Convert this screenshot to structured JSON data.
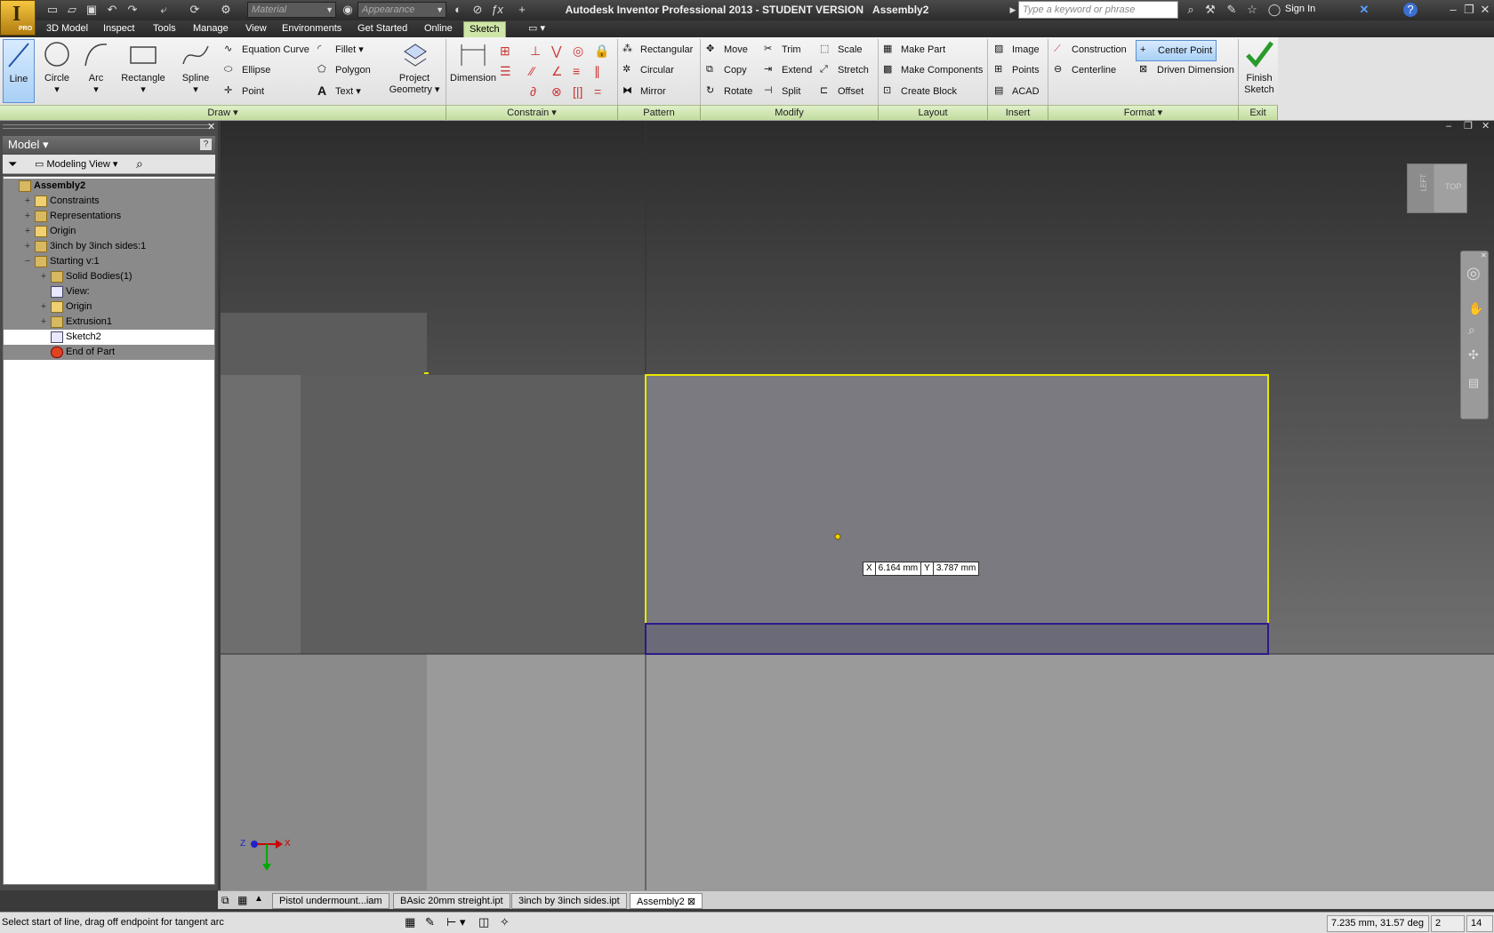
{
  "window": {
    "title": "Autodesk Inventor Professional 2013 - STUDENT VERSION",
    "document": "Assembly2",
    "app_badge": "PRO"
  },
  "qat": {
    "material_placeholder": "Material",
    "appearance_placeholder": "Appearance",
    "search_placeholder": "Type a keyword or phrase",
    "sign_in": "Sign In"
  },
  "menu_tabs": [
    "3D Model",
    "Inspect",
    "Tools",
    "Manage",
    "View",
    "Environments",
    "Get Started",
    "Online",
    "Sketch"
  ],
  "ribbon": {
    "draw": {
      "label": "Draw",
      "line": "Line",
      "circle": "Circle",
      "arc": "Arc",
      "rectangle": "Rectangle",
      "spline": "Spline",
      "equation_curve": "Equation Curve",
      "ellipse": "Ellipse",
      "point": "Point",
      "fillet": "Fillet",
      "polygon": "Polygon",
      "text": "Text",
      "project_geometry": [
        "Project",
        "Geometry"
      ]
    },
    "constrain": {
      "label": "Constrain",
      "dimension": "Dimension"
    },
    "pattern": {
      "label": "Pattern",
      "rectangular": "Rectangular",
      "circular": "Circular",
      "mirror": "Mirror"
    },
    "modify": {
      "label": "Modify",
      "move": "Move",
      "copy": "Copy",
      "rotate": "Rotate",
      "trim": "Trim",
      "extend": "Extend",
      "split": "Split",
      "scale": "Scale",
      "stretch": "Stretch",
      "offset": "Offset"
    },
    "layout": {
      "label": "Layout",
      "make_part": "Make Part",
      "make_components": "Make Components",
      "create_block": "Create Block"
    },
    "insert": {
      "label": "Insert",
      "image": "Image",
      "points": "Points",
      "acad": "ACAD"
    },
    "format": {
      "label": "Format",
      "construction": "Construction",
      "centerline": "Centerline",
      "center_point": "Center Point",
      "driven_dimension": "Driven Dimension"
    },
    "exit": {
      "label": "Exit",
      "finish_sketch": [
        "Finish",
        "Sketch"
      ]
    }
  },
  "browser": {
    "title": "Model",
    "view_mode": "Modeling View",
    "nodes": [
      {
        "label": "Assembly2",
        "level": 0,
        "expander": "",
        "bold": true
      },
      {
        "label": "Constraints",
        "level": 1,
        "expander": "+"
      },
      {
        "label": "Representations",
        "level": 1,
        "expander": "+"
      },
      {
        "label": "Origin",
        "level": 1,
        "expander": "+"
      },
      {
        "label": "3inch by 3inch sides:1",
        "level": 1,
        "expander": "+"
      },
      {
        "label": "Starting v:1",
        "level": 1,
        "expander": "−"
      },
      {
        "label": "Solid Bodies(1)",
        "level": 2,
        "expander": "+"
      },
      {
        "label": "View:",
        "level": 2,
        "expander": ""
      },
      {
        "label": "Origin",
        "level": 2,
        "expander": "+"
      },
      {
        "label": "Extrusion1",
        "level": 2,
        "expander": "+"
      },
      {
        "label": "Sketch2",
        "level": 2,
        "expander": "",
        "selected": true
      },
      {
        "label": "End of Part",
        "level": 2,
        "expander": ""
      }
    ]
  },
  "viewport": {
    "coord_x_label": "X",
    "coord_x_value": "6.164 mm",
    "coord_y_label": "Y",
    "coord_y_value": "3.787 mm",
    "viewcube_left": "LEFT",
    "viewcube_top": "TOP",
    "triad_z": "Z",
    "triad_x": "X"
  },
  "doc_tabs": [
    "Pistol undermount...iam",
    "BAsic 20mm streight.ipt",
    "3inch by 3inch sides.ipt",
    "Assembly2"
  ],
  "status": {
    "prompt": "Select start of line, drag off endpoint for tangent arc",
    "coords": "7.235 mm, 31.57 deg",
    "count1": "2",
    "count2": "14"
  }
}
